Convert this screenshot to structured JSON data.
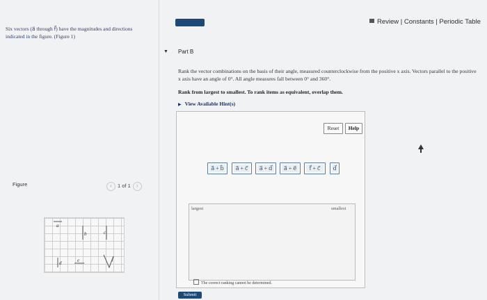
{
  "header": {
    "intro_text": "Six vectors (a⃗ through f⃗) have the magnitudes and directions indicated in the figure. (Figure 1)",
    "links": "Review | Constants | Periodic Table"
  },
  "part": {
    "title": "Part B",
    "question": "Rank the vector combinations on the basis of their angle, measured counterclockwise from the positive x axis. Vectors parallel to the positive x axis have an angle of 0°. All angle measures fall between 0° and 360°.",
    "rank_instruction": "Rank from largest to smallest. To rank items as equivalent, overlap them.",
    "hint_link": "View Available Hint(s)"
  },
  "toolbar": {
    "reset_label": "Reset",
    "help_label": "Help"
  },
  "chips": [
    "a⃗ + b⃗",
    "a⃗ + c⃗",
    "a⃗ + d⃗",
    "a⃗ + e⃗",
    "f⃗ + c⃗",
    "d⃗"
  ],
  "ranking": {
    "largest_label": "largest",
    "smallest_label": "smallest",
    "cannot_label": "The correct ranking cannot be determined."
  },
  "submit_label": "Submit",
  "figure": {
    "label": "Figure",
    "pager": "1 of 1",
    "vector_labels": [
      "a⃗",
      "b⃗",
      "c⃗",
      "d⃗",
      "e⃗",
      "f⃗"
    ]
  },
  "colors": {
    "accent": "#1b4a79",
    "chip_border": "#5c7c97"
  }
}
